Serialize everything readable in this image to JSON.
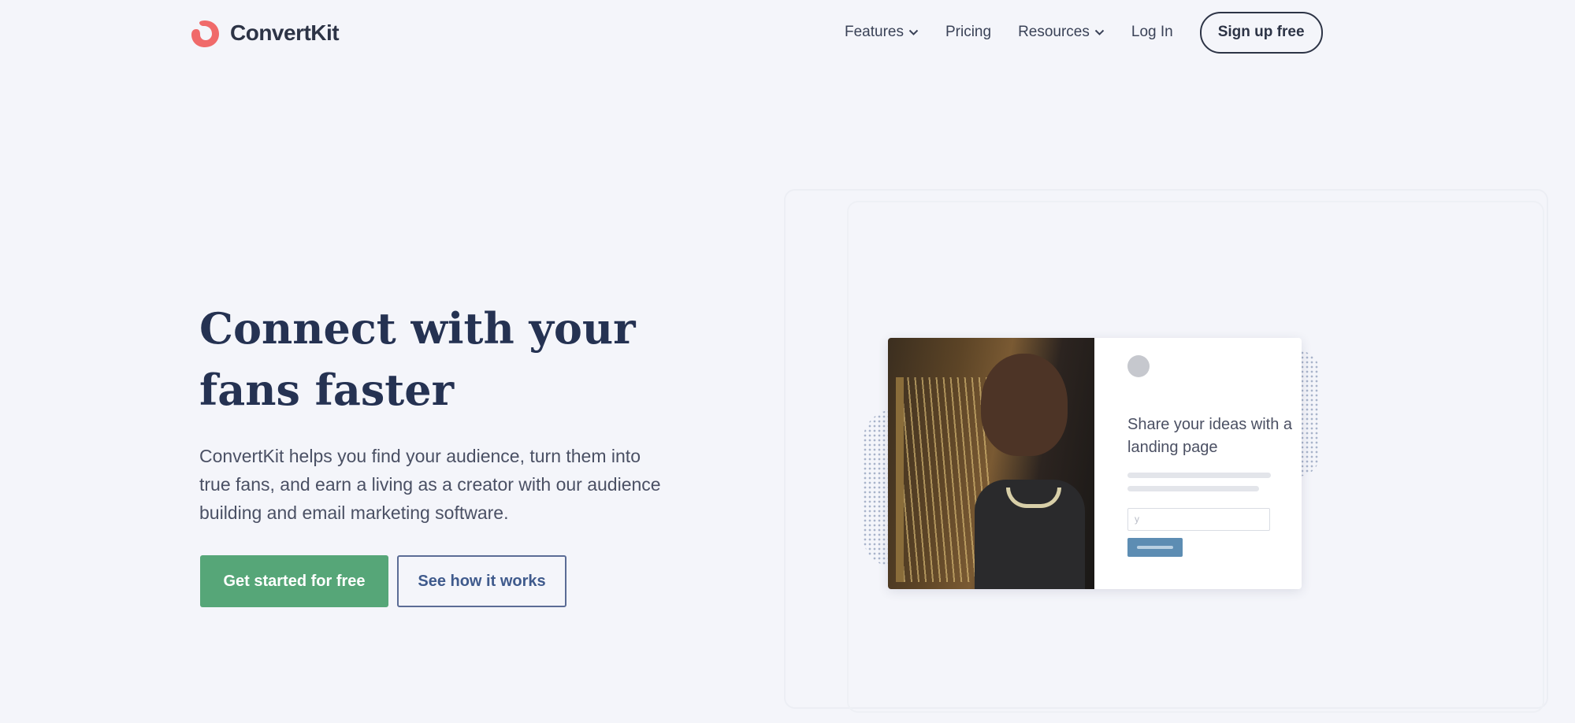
{
  "header": {
    "logo_text": "ConvertKit",
    "nav": [
      {
        "label": "Features",
        "has_dropdown": true
      },
      {
        "label": "Pricing",
        "has_dropdown": false
      },
      {
        "label": "Resources",
        "has_dropdown": true
      },
      {
        "label": "Log In",
        "has_dropdown": false
      }
    ],
    "signup_label": "Sign up free"
  },
  "hero": {
    "headline_line1": "Connect with your",
    "headline_line2": "fans faster",
    "description": "ConvertKit helps you find your audience, turn them into true fans, and earn a living as a creator with our audience building and email marketing software.",
    "primary_cta": "Get started for free",
    "secondary_cta": "See how it works"
  },
  "illustration": {
    "card_heading": "Share your ideas with a landing page",
    "input_placeholder": "y"
  },
  "colors": {
    "brand": "#f06a6a",
    "primary_button": "#56a678",
    "headline": "#253252",
    "background": "#f4f5fa"
  }
}
